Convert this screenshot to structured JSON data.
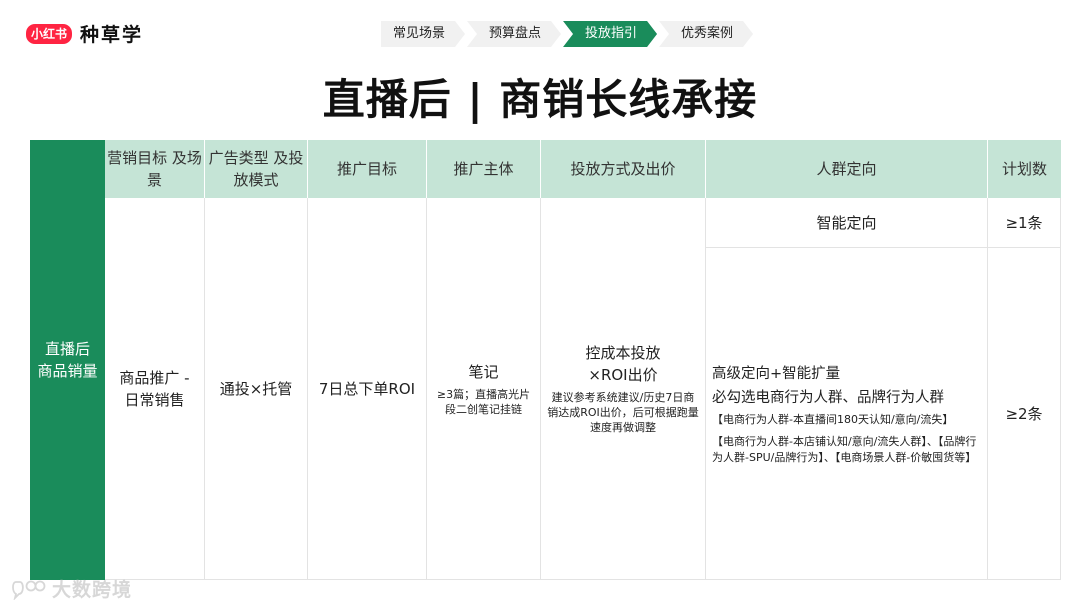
{
  "brand": {
    "badge": "小红书",
    "name": "种草学"
  },
  "steps": [
    {
      "label": "常见场景",
      "active": false
    },
    {
      "label": "预算盘点",
      "active": false
    },
    {
      "label": "投放指引",
      "active": true
    },
    {
      "label": "优秀案例",
      "active": false
    }
  ],
  "title": "直播后 | 商销长线承接",
  "table": {
    "side_label": "直播后 商品销量",
    "headers": {
      "goal": "营销目标 及场景",
      "ad_type": "广告类型 及投放模式",
      "target": "推广目标",
      "subject": "推广主体",
      "bid": "投放方式及出价",
      "audience": "人群定向",
      "plans": "计划数"
    },
    "row": {
      "goal": "商品推广 -日常销售",
      "ad_type": "通投×托管",
      "target": "7日总下单ROI",
      "subject_main": "笔记",
      "subject_note": "≥3篇；直播高光片段二创笔记挂链",
      "bid_main_1": "控成本投放",
      "bid_main_2": "×ROI出价",
      "bid_note": "建议参考系统建议/历史7日商销达成ROI出价，后可根据跑量速度再做调整",
      "smart_label": "智能定向",
      "smart_plans": "≥1条",
      "adv_line1": "高级定向+智能扩量",
      "adv_line2": "必勾选电商行为人群、品牌行为人群",
      "adv_tag1": "【电商行为人群-本直播间180天认知/意向/流失】",
      "adv_tag2": "【电商行为人群-本店铺认知/意向/流失人群】、【品牌行为人群-SPU/品牌行为】、【电商场景人群-价敏囤货等】",
      "adv_plans": "≥2条"
    }
  },
  "watermark": {
    "text": "大数跨境",
    "icon": "bubble-logo-icon"
  },
  "colors": {
    "accent": "#1a8c5b",
    "header_bg": "#c5e4d6",
    "brand_red": "#ff2442"
  }
}
